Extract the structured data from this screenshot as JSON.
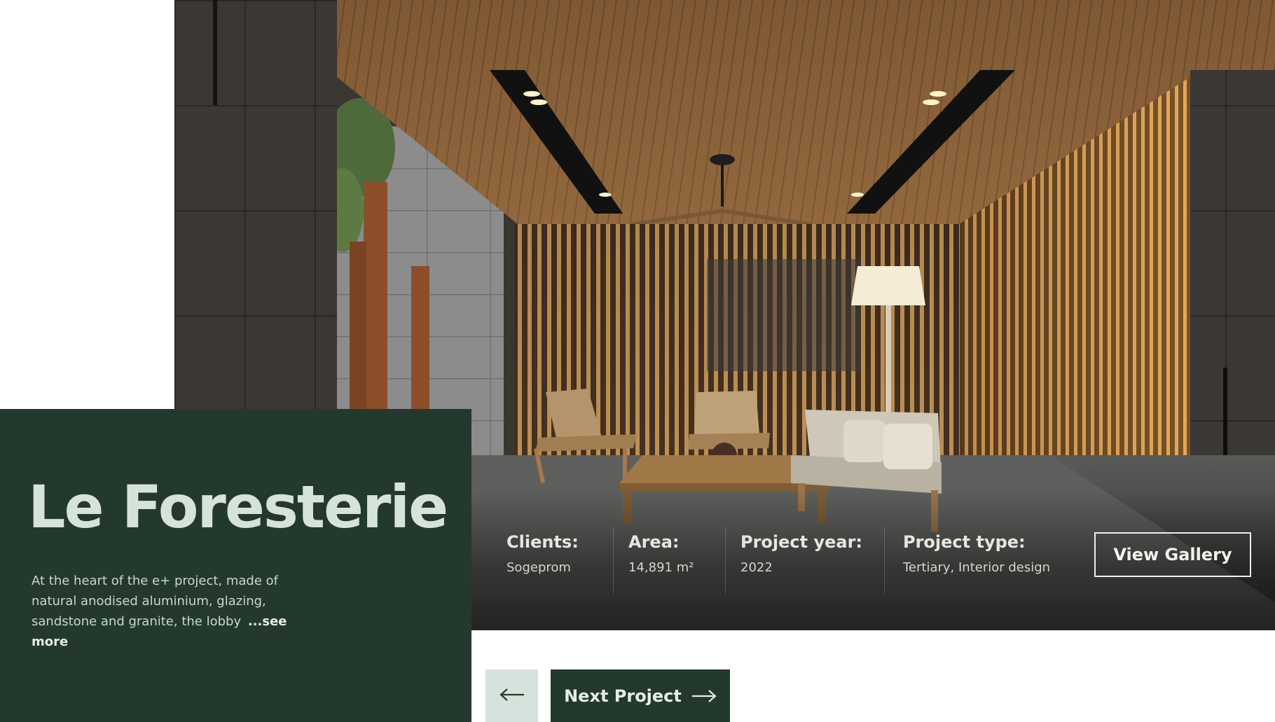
{
  "project": {
    "title": "Le Foresterie",
    "description": "At the heart of the e+ project, made of natural anodised aluminium, glazing, sandstone and granite, the lobby",
    "see_more": "...see more"
  },
  "details": [
    {
      "label": "Clients:",
      "value": "Sogeprom"
    },
    {
      "label": "Area:",
      "value": "14,891 m²"
    },
    {
      "label": "Project year:",
      "value": "2022"
    },
    {
      "label": "Project type:",
      "value": "Tertiary, Interior design"
    }
  ],
  "actions": {
    "view_gallery": "View Gallery",
    "next_project": "Next Project"
  },
  "icons": {
    "prev": "arrow-left-icon",
    "next": "arrow-right-icon"
  },
  "colors": {
    "panel_green": "#24392e",
    "mint": "#d6e3dc",
    "text_light": "#e9e5de"
  }
}
